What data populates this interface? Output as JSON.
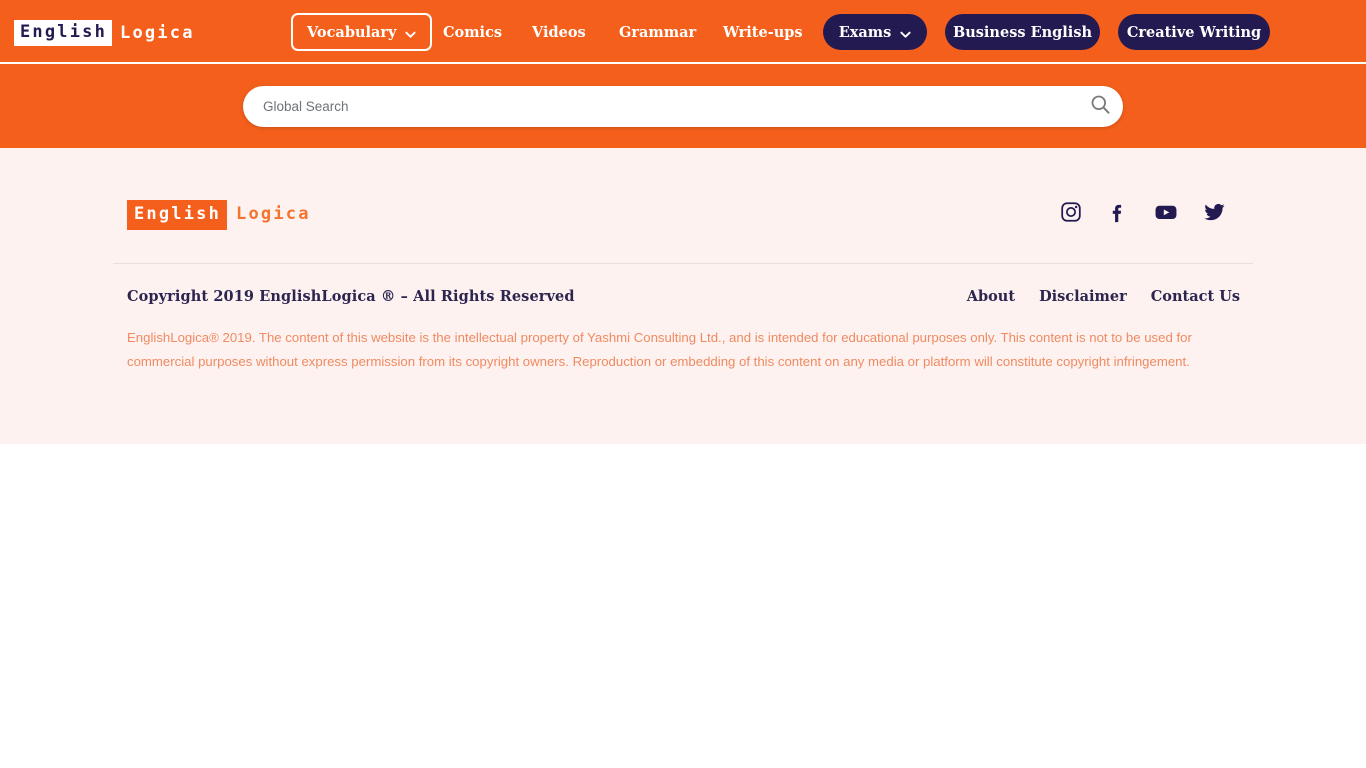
{
  "colors": {
    "orange": "#F4601C",
    "navy": "#231A52",
    "footer_bg": "#FDF2EF",
    "disclaimer_text": "#F08A62",
    "logo_orange_text": "#F4742E"
  },
  "header": {
    "logo": {
      "mark": "English",
      "rest": "Logica"
    },
    "nav": {
      "vocabulary": {
        "label": "Vocabulary",
        "icon": "chevron-down-icon"
      },
      "comics": "Comics",
      "videos": "Videos",
      "grammar": "Grammar",
      "writeups": "Write-ups"
    },
    "buttons": {
      "exams": {
        "label": "Exams",
        "icon": "chevron-down-icon"
      },
      "business_english": "Business English",
      "creative_writing": "Creative Writing"
    }
  },
  "search": {
    "placeholder": "Global Search",
    "value": "",
    "icon": "search-icon"
  },
  "footer": {
    "logo": {
      "mark": "English",
      "rest": "Logica"
    },
    "socials": [
      {
        "name": "instagram-icon",
        "label": "Instagram"
      },
      {
        "name": "facebook-icon",
        "label": "Facebook"
      },
      {
        "name": "youtube-icon",
        "label": "YouTube"
      },
      {
        "name": "twitter-icon",
        "label": "Twitter"
      }
    ],
    "copyright": "Copyright 2019 EnglishLogica ® – All Rights Reserved",
    "links": [
      {
        "label": "About"
      },
      {
        "label": "Disclaimer"
      },
      {
        "label": "Contact Us"
      }
    ],
    "disclaimer": "EnglishLogica® 2019. The content of this website is the intellectual property of Yashmi Consulting Ltd., and is intended for educational purposes only. This content is not to be used for commercial purposes without express permission from its copyright owners. Reproduction or embedding of this content on any media or platform will constitute copyright infringement."
  }
}
